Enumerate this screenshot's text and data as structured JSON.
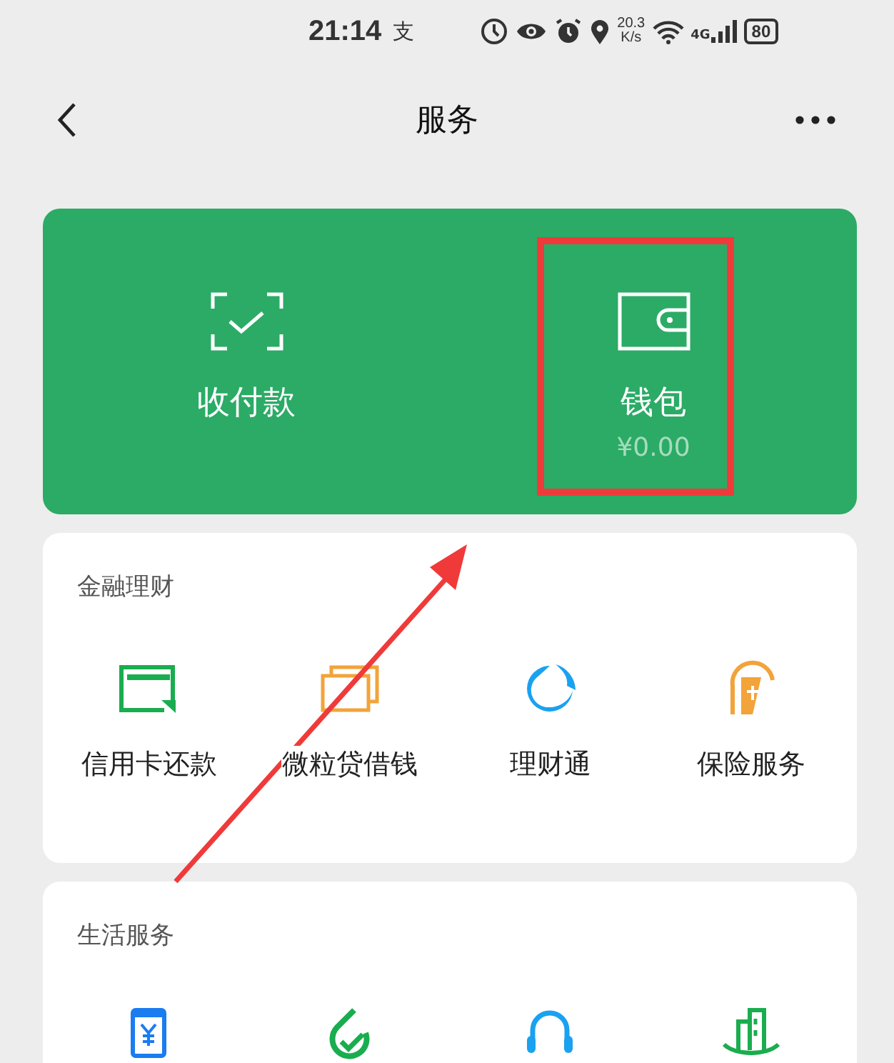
{
  "status_bar": {
    "time": "21:14",
    "app_glyph": "支",
    "net_speed": "20.3",
    "net_unit": "K/s",
    "network": "4G",
    "battery": "80"
  },
  "header": {
    "title": "服务"
  },
  "top_card": {
    "items": [
      {
        "label": "收付款"
      },
      {
        "label": "钱包",
        "amount": "¥0.00"
      }
    ]
  },
  "finance": {
    "title": "金融理财",
    "items": [
      {
        "label": "信用卡还款"
      },
      {
        "label": "微粒贷借钱"
      },
      {
        "label": "理财通"
      },
      {
        "label": "保险服务"
      }
    ]
  },
  "life": {
    "title": "生活服务"
  }
}
